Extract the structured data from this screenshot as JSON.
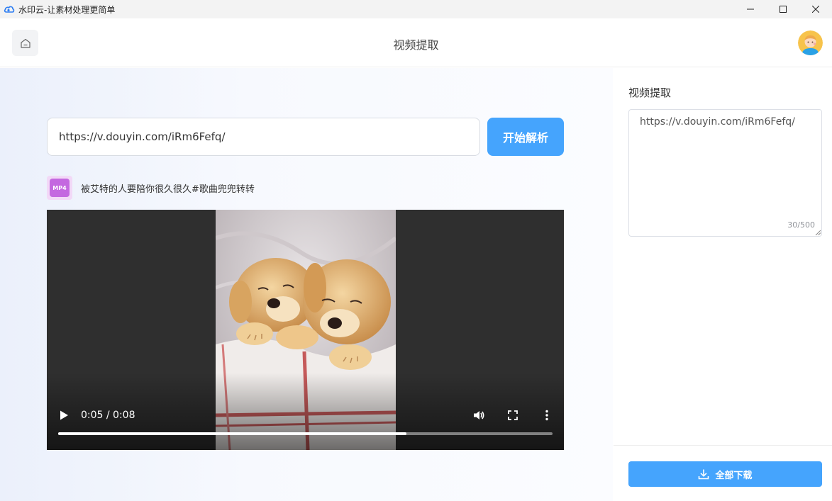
{
  "window": {
    "title": "水印云-让素材处理更简单",
    "icon": "cloud-logo-icon"
  },
  "header": {
    "title": "视频提取",
    "home_icon": "home-icon"
  },
  "main": {
    "url_value": "https://v.douyin.com/iRm6Fefq/",
    "parse_button": "开始解析",
    "media": {
      "badge": "MP4",
      "title": "被艾特的人要陪你很久很久#歌曲兜兜转转"
    },
    "player": {
      "time": "0:05 / 0:08",
      "progress": 0.705
    }
  },
  "side": {
    "title": "视频提取",
    "textarea_value": "https://v.douyin.com/iRm6Fefq/",
    "char_count": "30/500",
    "download_button": "全部下载"
  },
  "colors": {
    "accent": "#45a4fd",
    "badge": "#c468e0"
  }
}
